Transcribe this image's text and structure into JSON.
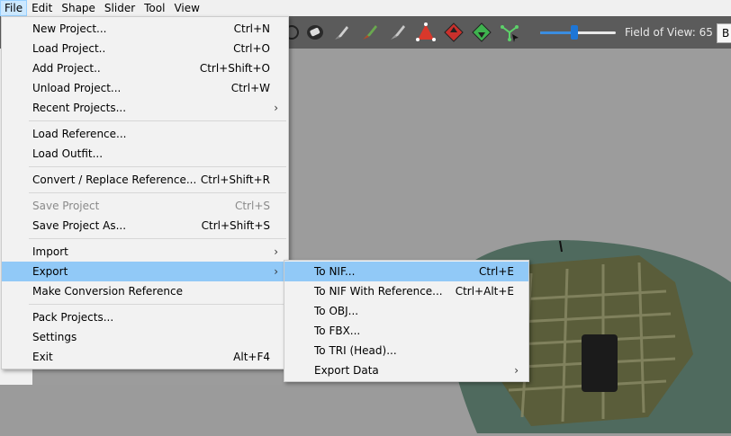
{
  "menubar": {
    "items": [
      "File",
      "Edit",
      "Shape",
      "Slider",
      "Tool",
      "View"
    ]
  },
  "toolbar": {
    "icons": [
      "eraser-icon",
      "brush-icon",
      "paint-brush-icon",
      "brush-variant-icon",
      "move-vertex-icon",
      "weight-up-icon",
      "weight-down-icon",
      "select-vertices-icon"
    ],
    "fov_label": "Field of View: 65",
    "fov_value": 65,
    "fov_slider_fraction": 0.45,
    "right_button_label": "B"
  },
  "file_menu": {
    "items": [
      {
        "label": "New Project...",
        "shortcut": "Ctrl+N"
      },
      {
        "label": "Load Project..",
        "shortcut": "Ctrl+O"
      },
      {
        "label": "Add Project..",
        "shortcut": "Ctrl+Shift+O"
      },
      {
        "label": "Unload Project...",
        "shortcut": "Ctrl+W"
      },
      {
        "label": "Recent Projects...",
        "shortcut": ""
      },
      {
        "label": "Load Reference...",
        "shortcut": ""
      },
      {
        "label": "Load Outfit...",
        "shortcut": ""
      },
      {
        "label": "Convert / Replace Reference...",
        "shortcut": "Ctrl+Shift+R"
      },
      {
        "label": "Save Project",
        "shortcut": "Ctrl+S"
      },
      {
        "label": "Save Project As...",
        "shortcut": "Ctrl+Shift+S"
      },
      {
        "label": "Import",
        "shortcut": ""
      },
      {
        "label": "Export",
        "shortcut": ""
      },
      {
        "label": "Make Conversion Reference",
        "shortcut": ""
      },
      {
        "label": "Pack Projects...",
        "shortcut": ""
      },
      {
        "label": "Settings",
        "shortcut": ""
      },
      {
        "label": "Exit",
        "shortcut": "Alt+F4"
      }
    ]
  },
  "export_menu": {
    "items": [
      {
        "label": "To NIF...",
        "shortcut": "Ctrl+E"
      },
      {
        "label": "To NIF With Reference...",
        "shortcut": "Ctrl+Alt+E"
      },
      {
        "label": "To OBJ...",
        "shortcut": ""
      },
      {
        "label": "To FBX...",
        "shortcut": ""
      },
      {
        "label": "To TRI (Head)...",
        "shortcut": ""
      },
      {
        "label": "Export Data",
        "shortcut": ""
      }
    ]
  },
  "colors": {
    "menu_highlight": "#91c9f7",
    "menubar_active": "#cce8ff",
    "toolbar_bg": "#5b5b5b",
    "viewport_bg": "#9c9c9c",
    "slider_accent": "#1e76d6"
  }
}
